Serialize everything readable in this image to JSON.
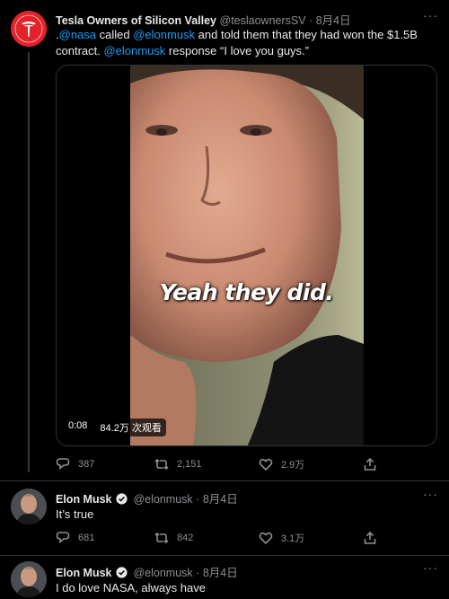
{
  "tweet1": {
    "name": "Tesla Owners of Silicon Valley",
    "handle": "@teslaownersSV",
    "separator": "·",
    "date": "8月4日",
    "text_prefix": ".",
    "mention1": "@nasa",
    "text_mid1": " called ",
    "mention2": "@elonmusk",
    "text_mid2": " and told them that they had won the $1.5B contract. ",
    "mention3": "@elonmusk",
    "text_end": " response “I love you guys.”",
    "video": {
      "caption": "Yeah they did.",
      "duration": "0:08",
      "views": "84.2万 次观看"
    },
    "actions": {
      "replies": "387",
      "retweets": "2,151",
      "likes": "2.9万"
    }
  },
  "tweet2": {
    "name": "Elon Musk",
    "handle": "@elonmusk",
    "separator": "·",
    "date": "8月4日",
    "text": "It’s true",
    "actions": {
      "replies": "681",
      "retweets": "842",
      "likes": "3.1万"
    }
  },
  "tweet3": {
    "name": "Elon Musk",
    "handle": "@elonmusk",
    "separator": "·",
    "date": "8月4日",
    "text": "I do love NASA, always have"
  },
  "more_glyph": "···",
  "colors": {
    "accent": "#1d9bf0",
    "background": "#000000",
    "muted": "#8b8f93",
    "tesla_red": "#e3222a"
  }
}
